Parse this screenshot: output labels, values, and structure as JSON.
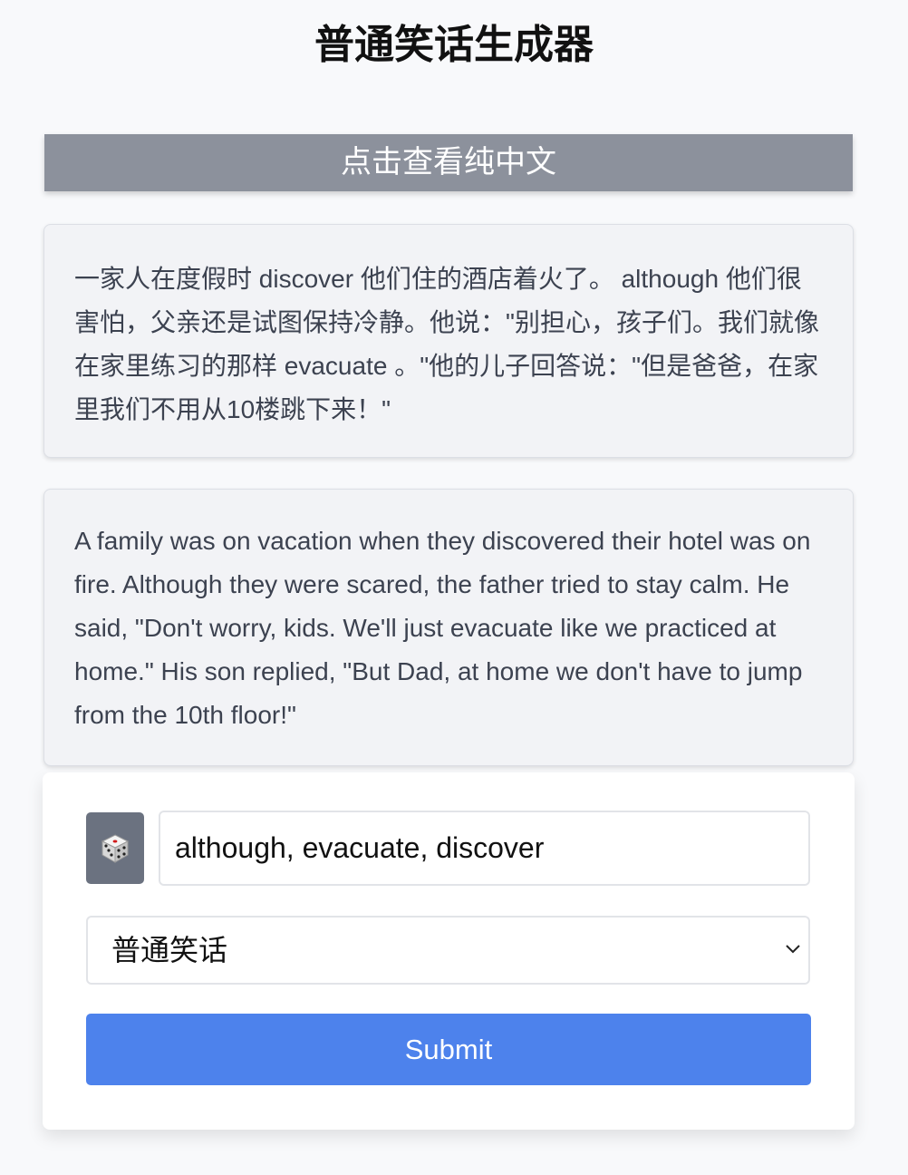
{
  "header": {
    "title": "普通笑话生成器"
  },
  "toggle": {
    "label": "点击查看纯中文"
  },
  "joke": {
    "mixed_text": "一家人在度假时 discover 他们住的酒店着火了。 although 他们很害怕，父亲还是试图保持冷静。他说：\"别担心，孩子们。我们就像在家里练习的那样 evacuate 。\"他的儿子回答说：\"但是爸爸，在家里我们不用从10楼跳下来！\"",
    "english_text": "A family was on vacation when they discovered their hotel was on fire. Although they were scared, the father tried to stay calm. He said, \"Don't worry, kids. We'll just evacuate like we practiced at home.\" His son replied, \"But Dad, at home we don't have to jump from the 10th floor!\""
  },
  "form": {
    "random_icon": "dice-icon",
    "words_value": "although, evacuate, discover",
    "style_selected": "普通笑话",
    "submit_label": "Submit"
  },
  "colors": {
    "toggle_bg": "#8c919c",
    "dice_bg": "#6b7280",
    "submit_bg": "#4d82ec",
    "card_bg": "#f2f3f6",
    "page_bg": "#f8f9fb"
  }
}
